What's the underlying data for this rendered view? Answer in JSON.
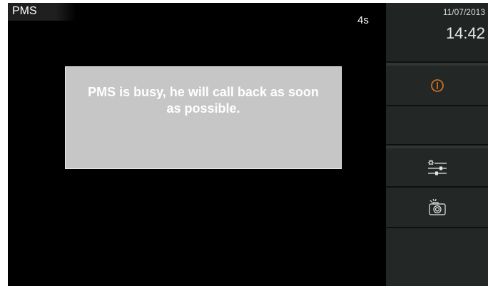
{
  "header": {
    "caller_name": "PMS",
    "timer": "4s"
  },
  "dialog": {
    "message": "PMS is busy, he will call back as soon as possible."
  },
  "sidebar": {
    "date": "11/07/2013",
    "time": "14:42",
    "buttons": [
      {
        "icon": "power-icon",
        "color": "#e0781e"
      },
      {
        "icon": "sliders-icon",
        "color": "#e8e8e8"
      },
      {
        "icon": "camera-icon",
        "color": "#e8e8e8"
      }
    ]
  },
  "colors": {
    "screen_bg": "#000000",
    "sidebar_bg": "#232826",
    "dialog_bg": "#c6c6c6",
    "accent_orange": "#e0781e"
  }
}
